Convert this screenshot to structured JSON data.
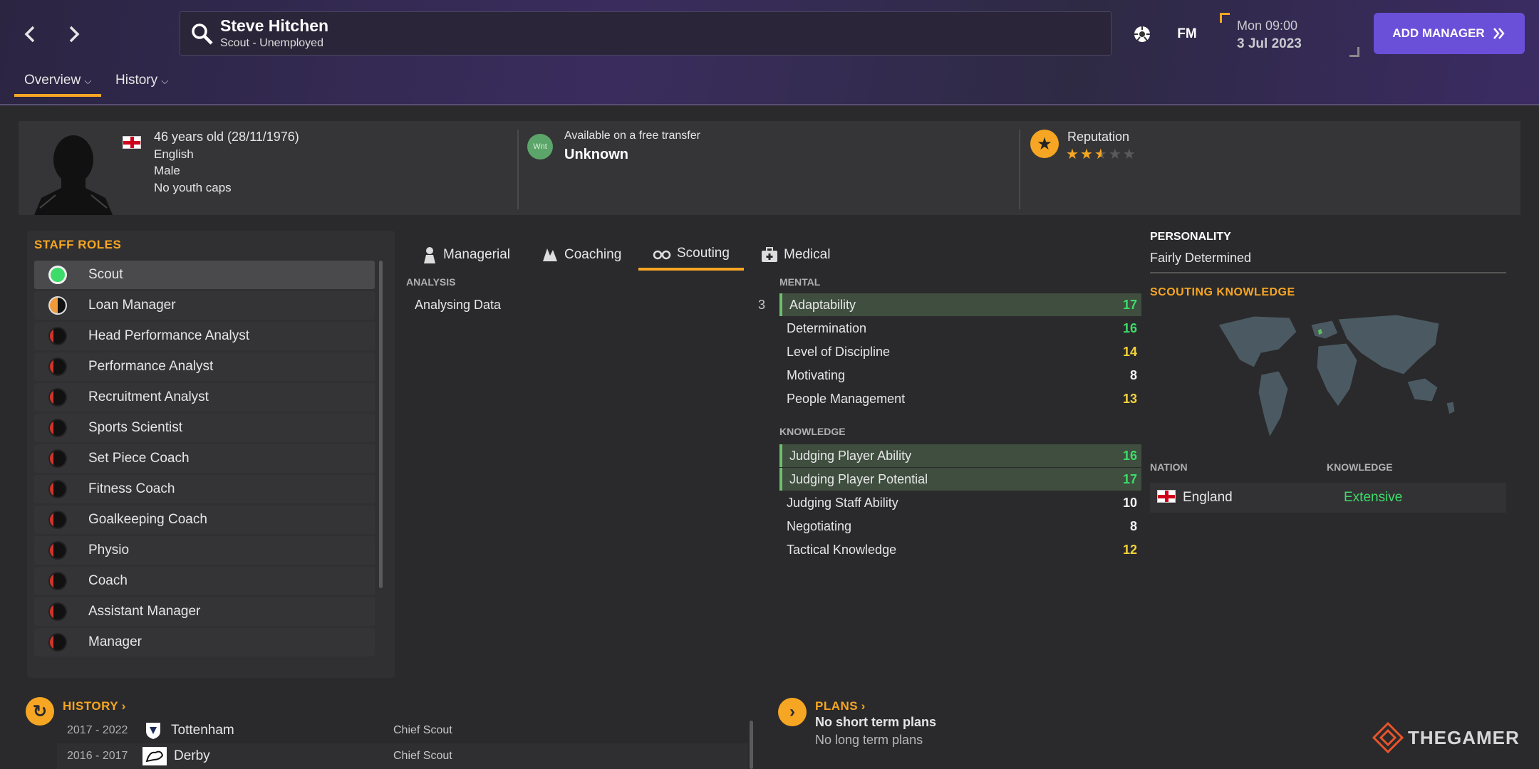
{
  "header": {
    "name": "Steve Hitchen",
    "subtitle": "Scout - Unemployed",
    "fm_label": "FM",
    "date_line1": "Mon 09:00",
    "date_line2": "3 Jul 2023",
    "add_manager": "ADD MANAGER"
  },
  "tabs": [
    {
      "label": "Overview",
      "active": true
    },
    {
      "label": "History",
      "active": false
    }
  ],
  "profile": {
    "age": "46 years old (28/11/1976)",
    "nationality": "English",
    "gender": "Male",
    "caps": "No youth caps",
    "transfer_label": "Available on a free transfer",
    "transfer_badge": "Wnt",
    "transfer_value": "Unknown",
    "reputation_label": "Reputation",
    "reputation_stars": 2.5
  },
  "staff_roles": {
    "title": "STAFF ROLES",
    "items": [
      {
        "label": "Scout",
        "icon": "full-green-circle"
      },
      {
        "label": "Loan Manager",
        "icon": "half-orange-circle"
      },
      {
        "label": "Head Performance Analyst",
        "icon": "red-sliver-circle"
      },
      {
        "label": "Performance Analyst",
        "icon": "red-sliver-circle"
      },
      {
        "label": "Recruitment Analyst",
        "icon": "red-sliver-circle"
      },
      {
        "label": "Sports Scientist",
        "icon": "red-sliver-circle"
      },
      {
        "label": "Set Piece Coach",
        "icon": "red-sliver-circle"
      },
      {
        "label": "Fitness Coach",
        "icon": "red-sliver-circle"
      },
      {
        "label": "Goalkeeping Coach",
        "icon": "red-sliver-circle"
      },
      {
        "label": "Physio",
        "icon": "red-sliver-circle"
      },
      {
        "label": "Coach",
        "icon": "red-sliver-circle"
      },
      {
        "label": "Assistant Manager",
        "icon": "red-sliver-circle"
      },
      {
        "label": "Manager",
        "icon": "red-sliver-circle"
      }
    ]
  },
  "sub_tabs": [
    {
      "label": "Managerial",
      "icon": "managerial-icon"
    },
    {
      "label": "Coaching",
      "icon": "coaching-icon"
    },
    {
      "label": "Scouting",
      "icon": "binoculars-icon",
      "active": true
    },
    {
      "label": "Medical",
      "icon": "medical-kit-icon"
    }
  ],
  "analysis": {
    "title": "ANALYSIS",
    "items": [
      {
        "label": "Analysing Data",
        "value": "3"
      }
    ]
  },
  "mental": {
    "title": "MENTAL",
    "items": [
      {
        "label": "Adaptability",
        "value": "17",
        "highlight": true,
        "color": "green"
      },
      {
        "label": "Determination",
        "value": "16",
        "highlight": false,
        "color": "green"
      },
      {
        "label": "Level of Discipline",
        "value": "14",
        "highlight": false,
        "color": "yellow"
      },
      {
        "label": "Motivating",
        "value": "8",
        "highlight": false,
        "color": "white"
      },
      {
        "label": "People Management",
        "value": "13",
        "highlight": false,
        "color": "yellow"
      }
    ]
  },
  "knowledge": {
    "title": "KNOWLEDGE",
    "items": [
      {
        "label": "Judging Player Ability",
        "value": "16",
        "highlight": true,
        "color": "green"
      },
      {
        "label": "Judging Player Potential",
        "value": "17",
        "highlight": true,
        "color": "green"
      },
      {
        "label": "Judging Staff Ability",
        "value": "10",
        "highlight": false,
        "color": "white"
      },
      {
        "label": "Negotiating",
        "value": "8",
        "highlight": false,
        "color": "white"
      },
      {
        "label": "Tactical Knowledge",
        "value": "12",
        "highlight": false,
        "color": "yellow"
      }
    ]
  },
  "personality": {
    "title": "PERSONALITY",
    "value": "Fairly Determined"
  },
  "scouting_knowledge": {
    "title": "SCOUTING KNOWLEDGE",
    "col_nation": "NATION",
    "col_knowledge": "KNOWLEDGE",
    "rows": [
      {
        "nation": "England",
        "knowledge": "Extensive"
      }
    ]
  },
  "history": {
    "title": "HISTORY",
    "rows": [
      {
        "years": "2017 - 2022",
        "club": "Tottenham",
        "role": "Chief Scout"
      },
      {
        "years": "2016 - 2017",
        "club": "Derby",
        "role": "Chief Scout"
      }
    ]
  },
  "plans": {
    "title": "PLANS",
    "short": "No short term plans",
    "long": "No long term plans"
  },
  "watermark": "THEGAMER",
  "colors": {
    "accent": "#f6a623",
    "purple_button": "#6a4fd8",
    "green_value": "#3ddc6a",
    "yellow_value": "#f2d23b"
  }
}
